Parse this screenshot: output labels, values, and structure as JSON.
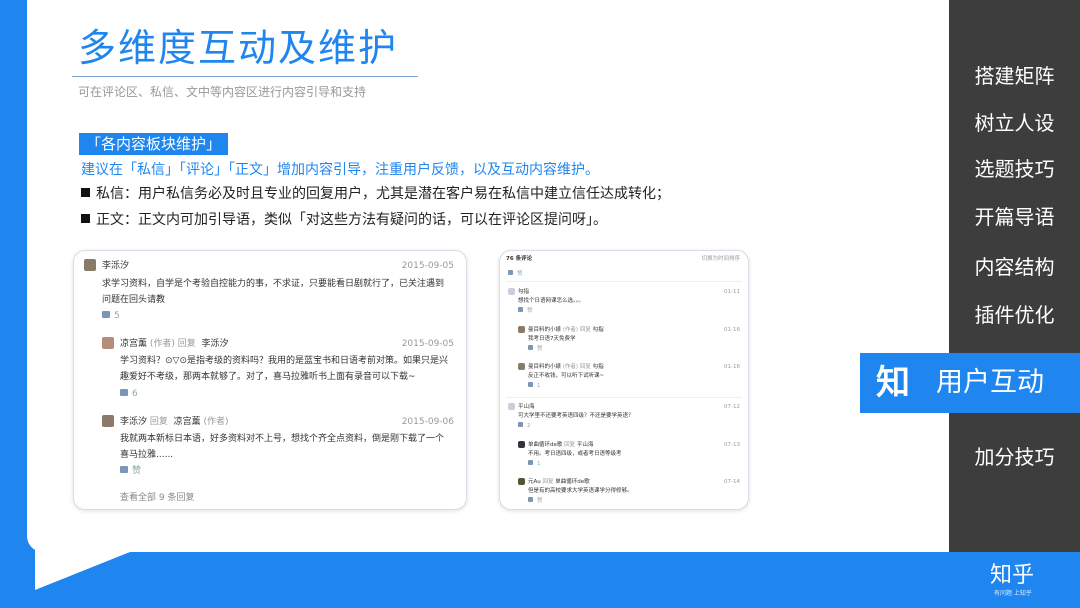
{
  "slide": {
    "title": "多维度互动及维护",
    "subtitle": "可在评论区、私信、文中等内容区进行内容引导和支持",
    "tag": "「各内容板块维护」",
    "lead": "建议在「私信」「评论」「正文」增加内容引导，注重用户反馈，以及互动内容维护。",
    "bullets": [
      "私信：用户私信务必及时且专业的回复用户，尤其是潜在客户易在私信中建立信任达成转化；",
      "正文：正文内可加引导语，类似「对这些方法有疑问的话，可以在评论区提问呀」。"
    ]
  },
  "sidebar": {
    "items": [
      "搭建矩阵",
      "树立人设",
      "选题技巧",
      "开篇导语",
      "内容结构",
      "插件优化",
      "用户互动",
      "加分技巧"
    ],
    "active_index": 6,
    "active_glyph": "知"
  },
  "logo": {
    "text": "知乎",
    "slogan": "有问题 上知乎"
  },
  "card1": {
    "comments": [
      {
        "user": "李泺汐",
        "date": "2015-09-05",
        "text": "求学习资料，自学是个考验自控能力的事，不求证，只要能看日剧就行了，已关注遇到问题在回头请教",
        "likes": "5"
      },
      {
        "user": "凉宫薰",
        "role": "(作者)",
        "reply": "回复",
        "to": "李泺汐",
        "date": "2015-09-05",
        "text": "学习资料？⊙▽⊙是指考级的资料吗？我用的是蓝宝书和日语考前对策。如果只是兴趣爱好不考级，那两本就够了。对了，喜马拉雅听书上面有录音可以下载~",
        "likes": "6"
      },
      {
        "user": "李泺汐",
        "reply": "回复",
        "to": "凉宫薰",
        "role": "(作者)",
        "date": "2015-09-06",
        "text": "我就两本新标日本语，好多资料对不上号，想找个齐全点资料，倒是刚下载了一个喜马拉雅......",
        "likes": "赞"
      }
    ],
    "footer": "查看全部 9 条回复"
  },
  "card2": {
    "header": "76 条评论",
    "header_right": "切换为时间排序",
    "top_like": "赞",
    "comments": [
      {
        "user": "勾指",
        "date": "01-11",
        "text": "想找个日语网课怎么选。。。",
        "likes": "赞"
      },
      {
        "user": "曼目料的小婊",
        "role": "(作者)",
        "reply": "回复",
        "to": "勾指",
        "date": "01-16",
        "text": "我考日语7天免费学",
        "likes": "赞"
      },
      {
        "user": "曼目料的小婊",
        "role": "(作者)",
        "reply": "回复",
        "to": "勾指",
        "date": "01-16",
        "text": "反正不收钱，可以听下试听课~",
        "likes": "1"
      },
      {
        "user": "平山海",
        "date": "07-12",
        "text": "可大学里不还要考英语四级？不还是要学英语？",
        "likes": "2"
      },
      {
        "user": "单曲循环de歌",
        "reply": "回复",
        "to": "平山海",
        "date": "07-13",
        "text": "不用。考日语四级，或者考日语等级考",
        "likes": "1"
      },
      {
        "user": "元Au",
        "reply": "回复",
        "to": "单曲循环de歌",
        "date": "07-14",
        "text": "但是有的高校要求大学英语课学分得修够。",
        "likes": "赞"
      }
    ]
  }
}
